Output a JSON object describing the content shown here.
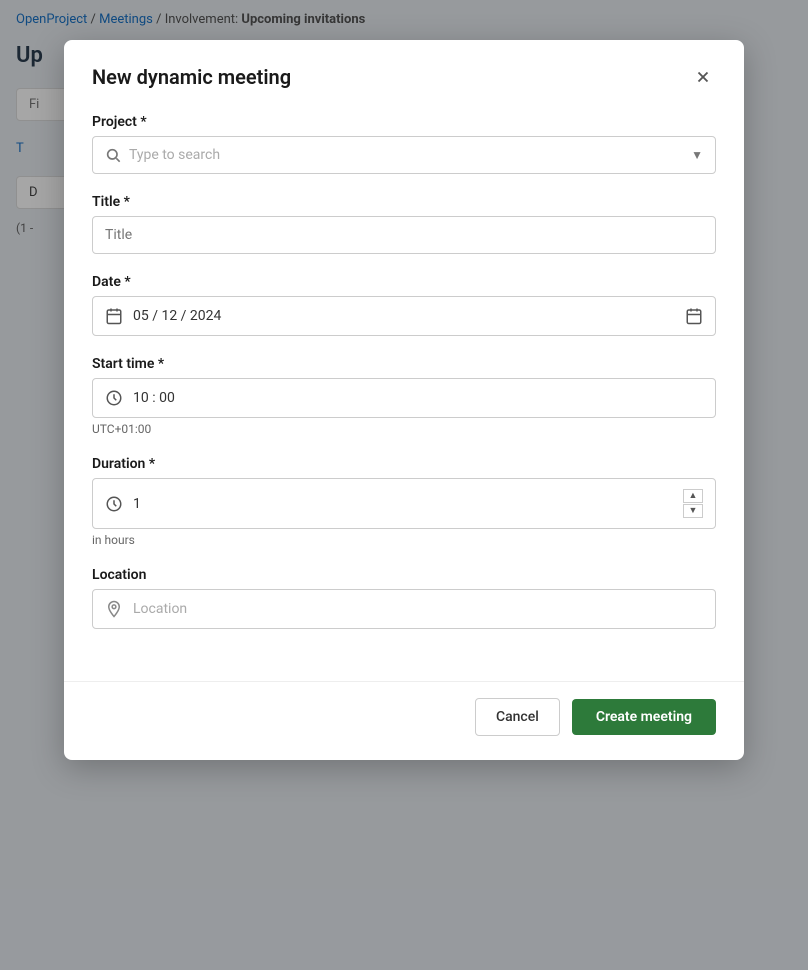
{
  "breadcrumb": {
    "parts": [
      {
        "label": "OpenProject",
        "href": "#"
      },
      {
        "label": "Meetings",
        "href": "#"
      },
      {
        "label": "Involvement: Upcoming invitations",
        "href": "#"
      }
    ],
    "separator": "/"
  },
  "page": {
    "title": "Up"
  },
  "filter_bar": {
    "placeholder": "Fi"
  },
  "tabs": [
    {
      "label": "T"
    }
  ],
  "list_item": {
    "label": "D"
  },
  "count": "(1 -",
  "modal": {
    "title": "New dynamic meeting",
    "close_label": "×",
    "fields": {
      "project": {
        "label": "Project",
        "required": true,
        "placeholder": "Type to search"
      },
      "title": {
        "label": "Title",
        "required": true,
        "placeholder": "Title",
        "value": ""
      },
      "date": {
        "label": "Date",
        "required": true,
        "value": "05 / 12 / 2024"
      },
      "start_time": {
        "label": "Start time",
        "required": true,
        "value": "10 : 00",
        "timezone": "UTC+01:00"
      },
      "duration": {
        "label": "Duration",
        "required": true,
        "value": "1",
        "helper": "in hours"
      },
      "location": {
        "label": "Location",
        "required": false,
        "placeholder": "Location"
      }
    },
    "footer": {
      "cancel_label": "Cancel",
      "create_label": "Create meeting"
    }
  }
}
